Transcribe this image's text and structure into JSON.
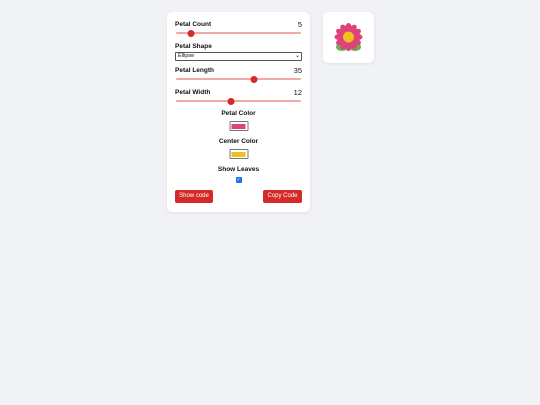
{
  "controls": {
    "petal_count": {
      "label": "Petal Count",
      "value": "5",
      "fraction": 0.12
    },
    "petal_shape": {
      "label": "Petal Shape",
      "selected": "Ellipse"
    },
    "petal_length": {
      "label": "Petal Length",
      "value": "35",
      "fraction": 0.62
    },
    "petal_width": {
      "label": "Petal Width",
      "value": "12",
      "fraction": 0.44
    },
    "petal_color": {
      "label": "Petal Color",
      "color": "#e0427a"
    },
    "center_color": {
      "label": "Center Color",
      "color": "#f0c020"
    },
    "show_leaves": {
      "label": "Show Leaves",
      "checked": true
    }
  },
  "buttons": {
    "show_code": "Show code",
    "copy_code": "Copy Code"
  },
  "theme": {
    "accent": "#d42a2a",
    "track": "#f3a8a8",
    "leaf": "#63b35a"
  }
}
